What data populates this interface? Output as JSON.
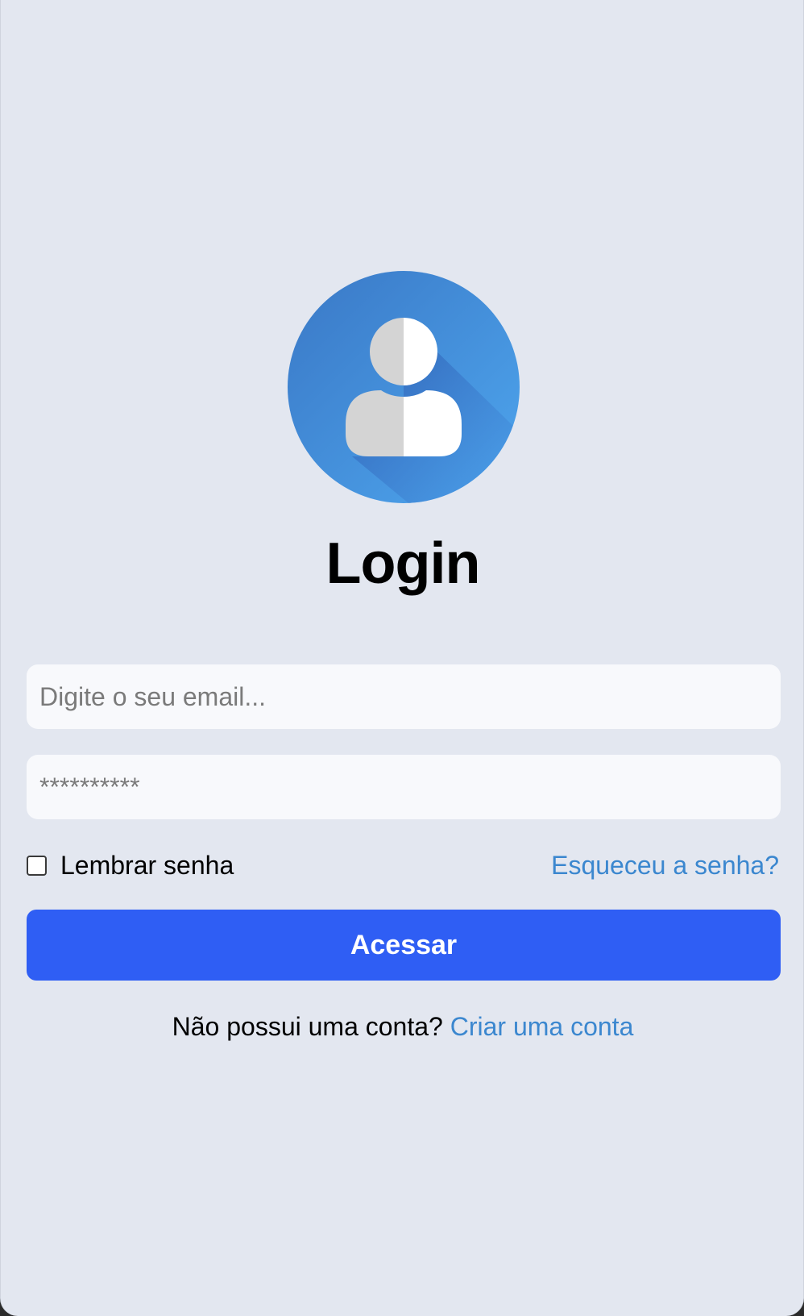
{
  "header": {
    "avatar_icon": "user-avatar-icon",
    "title": "Login"
  },
  "form": {
    "email_placeholder": "Digite o seu email...",
    "email_value": "",
    "password_placeholder": "**********",
    "password_value": "",
    "remember_label": "Lembrar senha",
    "remember_checked": false,
    "forgot_link": "Esqueceu a senha?",
    "submit_label": "Acessar"
  },
  "footer": {
    "prompt": "Não possui uma conta?",
    "signup_link": "Criar uma conta"
  },
  "colors": {
    "background": "#e3e7f0",
    "accent": "#2f5ef4",
    "link": "#3b87cf",
    "avatar_blue": "#3f86d8"
  }
}
